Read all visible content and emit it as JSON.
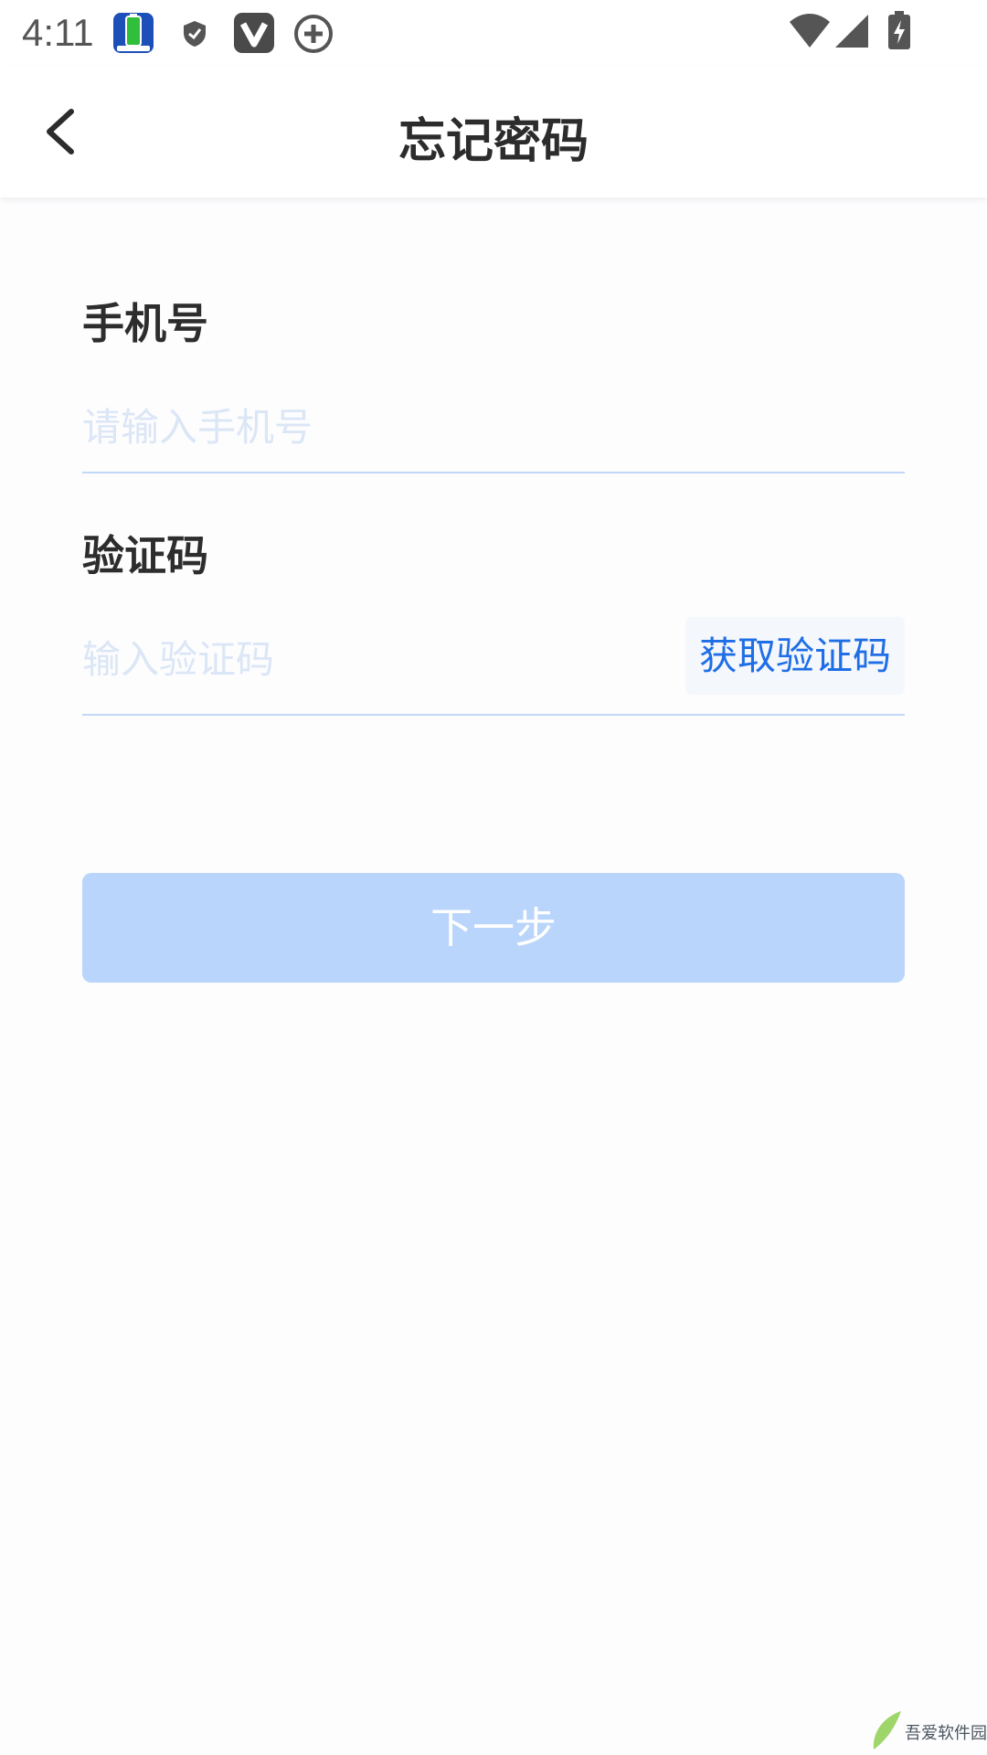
{
  "status_bar": {
    "time": "4:11",
    "left_icons": [
      "battery-app-icon",
      "shield-icon",
      "v-app-icon",
      "add-circle-icon"
    ],
    "right_icons": [
      "wifi-icon",
      "cellular-icon",
      "battery-charging-icon"
    ]
  },
  "header": {
    "title": "忘记密码",
    "back_icon": "chevron-left-icon"
  },
  "form": {
    "phone_label": "手机号",
    "phone_placeholder": "请输入手机号",
    "phone_value": "",
    "code_label": "验证码",
    "code_placeholder": "输入验证码",
    "code_value": "",
    "get_code_label": "获取验证码"
  },
  "next_label": "下一步",
  "watermark": {
    "text": "吾爱软件园"
  },
  "colors": {
    "accent": "#1f6ee6",
    "button_disabled": "#bad5fb",
    "underline": "#c3d8f7"
  }
}
